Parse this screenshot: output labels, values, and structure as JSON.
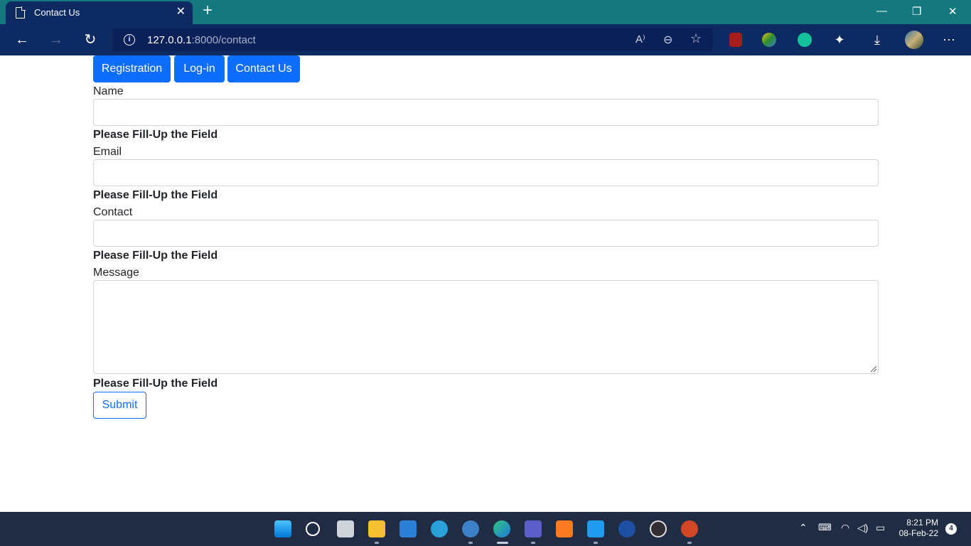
{
  "browser": {
    "tab_title": "Contact Us",
    "new_tab_symbol": "+",
    "url_host": "127.0.0.1",
    "url_path": ":8000/contact",
    "window_controls": {
      "minimize": "—",
      "restore": "❐",
      "close": "✕"
    },
    "icons": [
      "back-icon",
      "forward-icon",
      "refresh-icon",
      "info-icon",
      "read-aloud-icon",
      "zoom-out-icon",
      "favorites-icon",
      "ublock-icon",
      "extension-icon",
      "grammarly-icon",
      "extensions-puzzle-icon",
      "downloads-icon",
      "profile-avatar",
      "more-icon"
    ],
    "read_aloud_label": "A⁾",
    "colors": {
      "tabbar": "#14787e",
      "toolbar": "#0d2a63"
    }
  },
  "nav": {
    "items": [
      {
        "label": "Registration"
      },
      {
        "label": "Log-in"
      },
      {
        "label": "Contact Us"
      }
    ],
    "color": "#0d6efd"
  },
  "form": {
    "name": {
      "label": "Name",
      "value": "",
      "error": "Please Fill-Up the Field"
    },
    "email": {
      "label": "Email",
      "value": "",
      "error": "Please Fill-Up the Field"
    },
    "contact": {
      "label": "Contact",
      "value": "",
      "error": "Please Fill-Up the Field"
    },
    "message": {
      "label": "Message",
      "value": "",
      "error": "Please Fill-Up the Field"
    },
    "submit_label": "Submit"
  },
  "taskbar": {
    "apps": [
      "start-icon",
      "search-icon",
      "task-view-icon",
      "file-explorer-icon",
      "mail-icon",
      "telegram-icon",
      "qbittorrent-icon",
      "edge-icon",
      "teams-icon",
      "xampp-icon",
      "vscode-icon",
      "app-icon",
      "obs-icon",
      "powerpoint-icon"
    ],
    "time": "8:21 PM",
    "date": "08-Feb-22",
    "notification_count": "4"
  }
}
